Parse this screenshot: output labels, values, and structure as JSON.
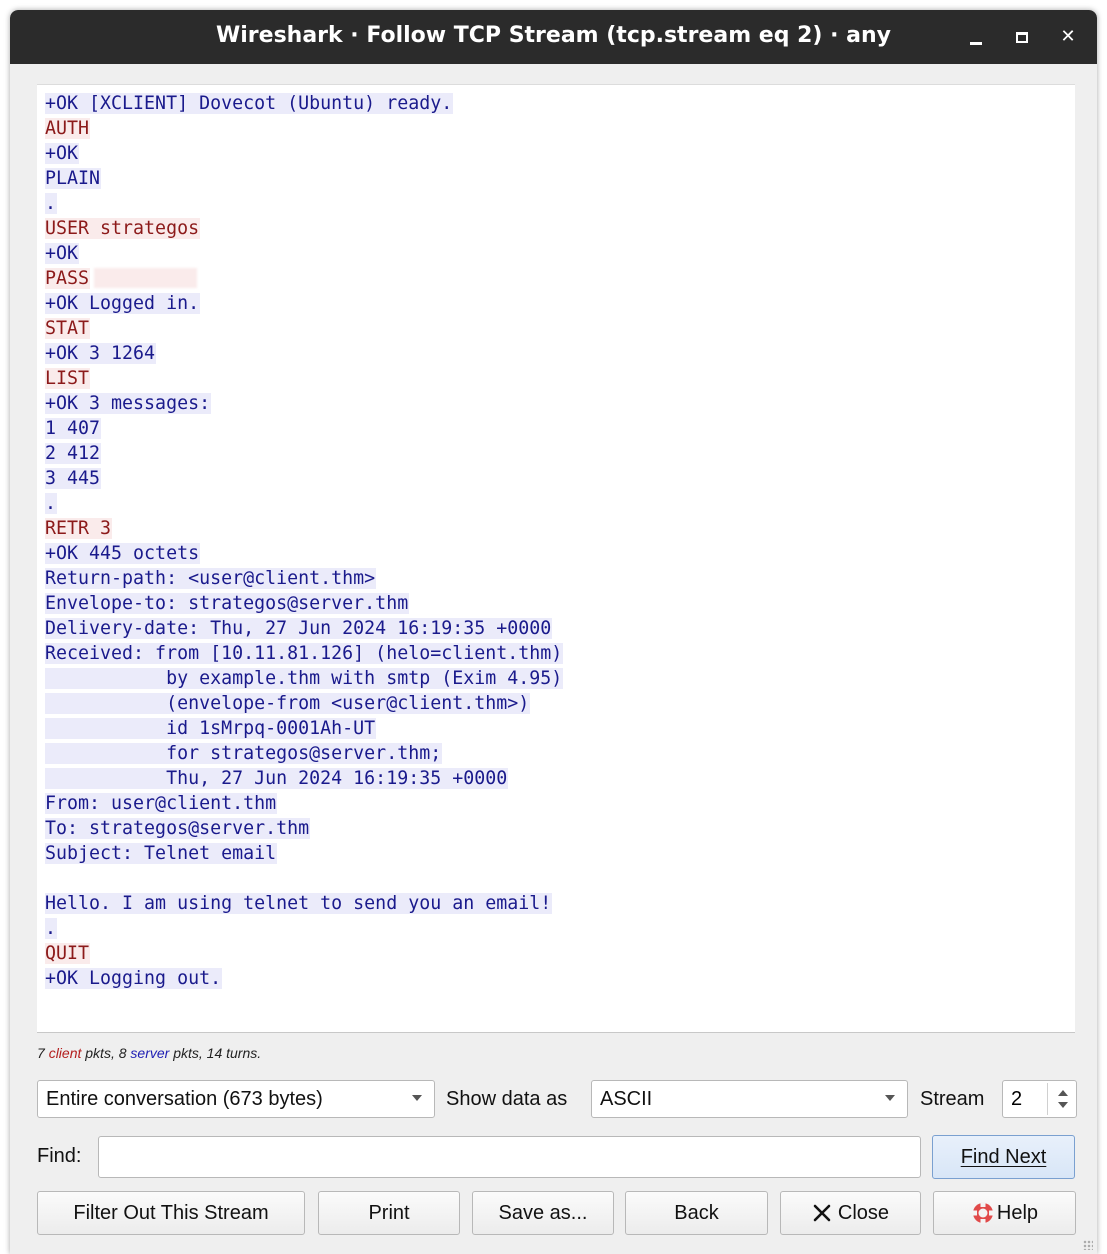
{
  "window": {
    "title": "Wireshark · Follow TCP Stream (tcp.stream eq 2) · any",
    "controls": {
      "minimize": "minimize-icon",
      "maximize": "maximize-icon",
      "close": "close-icon"
    }
  },
  "stream_lines": [
    {
      "dir": "server",
      "text": "+OK [XCLIENT] Dovecot (Ubuntu) ready."
    },
    {
      "dir": "client",
      "text": "AUTH"
    },
    {
      "dir": "server",
      "text": "+OK"
    },
    {
      "dir": "server",
      "text": "PLAIN"
    },
    {
      "dir": "server",
      "text": "."
    },
    {
      "dir": "client",
      "text": "USER strategos"
    },
    {
      "dir": "server",
      "text": "+OK"
    },
    {
      "dir": "client",
      "text": "PASS",
      "redacted": true
    },
    {
      "dir": "server",
      "text": "+OK Logged in."
    },
    {
      "dir": "client",
      "text": "STAT"
    },
    {
      "dir": "server",
      "text": "+OK 3 1264"
    },
    {
      "dir": "client",
      "text": "LIST"
    },
    {
      "dir": "server",
      "text": "+OK 3 messages:"
    },
    {
      "dir": "server",
      "text": "1 407"
    },
    {
      "dir": "server",
      "text": "2 412"
    },
    {
      "dir": "server",
      "text": "3 445"
    },
    {
      "dir": "server",
      "text": "."
    },
    {
      "dir": "client",
      "text": "RETR 3"
    },
    {
      "dir": "server",
      "text": "+OK 445 octets"
    },
    {
      "dir": "server",
      "text": "Return-path: <user@client.thm>"
    },
    {
      "dir": "server",
      "text": "Envelope-to: strategos@server.thm"
    },
    {
      "dir": "server",
      "text": "Delivery-date: Thu, 27 Jun 2024 16:19:35 +0000"
    },
    {
      "dir": "server",
      "text": "Received: from [10.11.81.126] (helo=client.thm)"
    },
    {
      "dir": "server",
      "text": "           by example.thm with smtp (Exim 4.95)"
    },
    {
      "dir": "server",
      "text": "           (envelope-from <user@client.thm>)"
    },
    {
      "dir": "server",
      "text": "           id 1sMrpq-0001Ah-UT"
    },
    {
      "dir": "server",
      "text": "           for strategos@server.thm;"
    },
    {
      "dir": "server",
      "text": "           Thu, 27 Jun 2024 16:19:35 +0000"
    },
    {
      "dir": "server",
      "text": "From: user@client.thm"
    },
    {
      "dir": "server",
      "text": "To: strategos@server.thm"
    },
    {
      "dir": "server",
      "text": "Subject: Telnet email"
    },
    {
      "dir": "blank",
      "text": ""
    },
    {
      "dir": "server",
      "text": "Hello. I am using telnet to send you an email!"
    },
    {
      "dir": "server",
      "text": "."
    },
    {
      "dir": "client",
      "text": "QUIT"
    },
    {
      "dir": "server",
      "text": "+OK Logging out."
    }
  ],
  "stats": {
    "client_count": "7",
    "client_word": "client",
    "middle": "pkts, 8",
    "server_word": "server",
    "tail": "pkts, 14 turns."
  },
  "controls": {
    "conversation_select": "Entire conversation (673 bytes)",
    "show_data_label": "Show data as",
    "show_data_select": "ASCII",
    "stream_label": "Stream",
    "stream_value": "2",
    "find_label": "Find:",
    "find_value": "",
    "find_next": "Find Next"
  },
  "buttons": {
    "filter_out": "Filter Out This Stream",
    "print": "Print",
    "save_as": "Save as...",
    "back": "Back",
    "close": "Close",
    "help": "Help"
  },
  "colors": {
    "client_text": "#8c1a1a",
    "client_bg": "#faebeb",
    "server_text": "#1a1a8c",
    "server_bg": "#ebebfa"
  }
}
